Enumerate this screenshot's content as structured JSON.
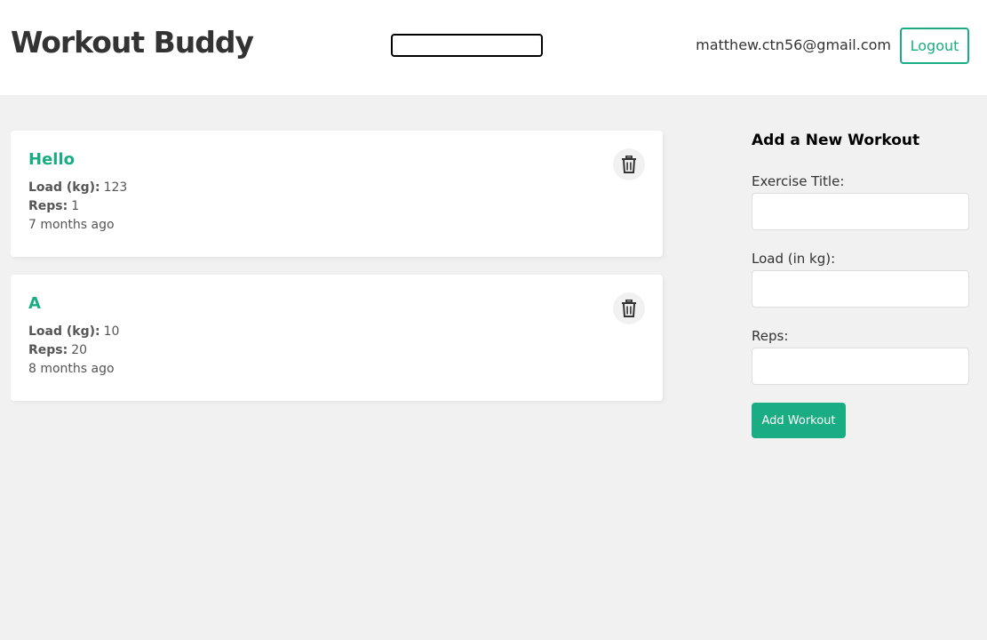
{
  "header": {
    "title": "Workout Buddy",
    "search_value": "",
    "user_email": "matthew.ctn56@gmail.com",
    "logout_label": "Logout"
  },
  "workouts": [
    {
      "title": "Hello",
      "load_label": "Load (kg):",
      "load": "123",
      "reps_label": "Reps:",
      "reps": "1",
      "time": "7 months ago",
      "delete_icon": "trash-icon"
    },
    {
      "title": "A",
      "load_label": "Load (kg):",
      "load": "10",
      "reps_label": "Reps:",
      "reps": "20",
      "time": "8 months ago",
      "delete_icon": "trash-icon"
    }
  ],
  "form": {
    "heading": "Add a New Workout",
    "title_label": "Exercise Title:",
    "title_value": "",
    "load_label": "Load (in kg):",
    "load_value": "",
    "reps_label": "Reps:",
    "reps_value": "",
    "submit_label": "Add Workout"
  },
  "colors": {
    "primary": "#1aac83",
    "background": "#f1f1f1",
    "card": "#ffffff",
    "text": "#333333"
  }
}
